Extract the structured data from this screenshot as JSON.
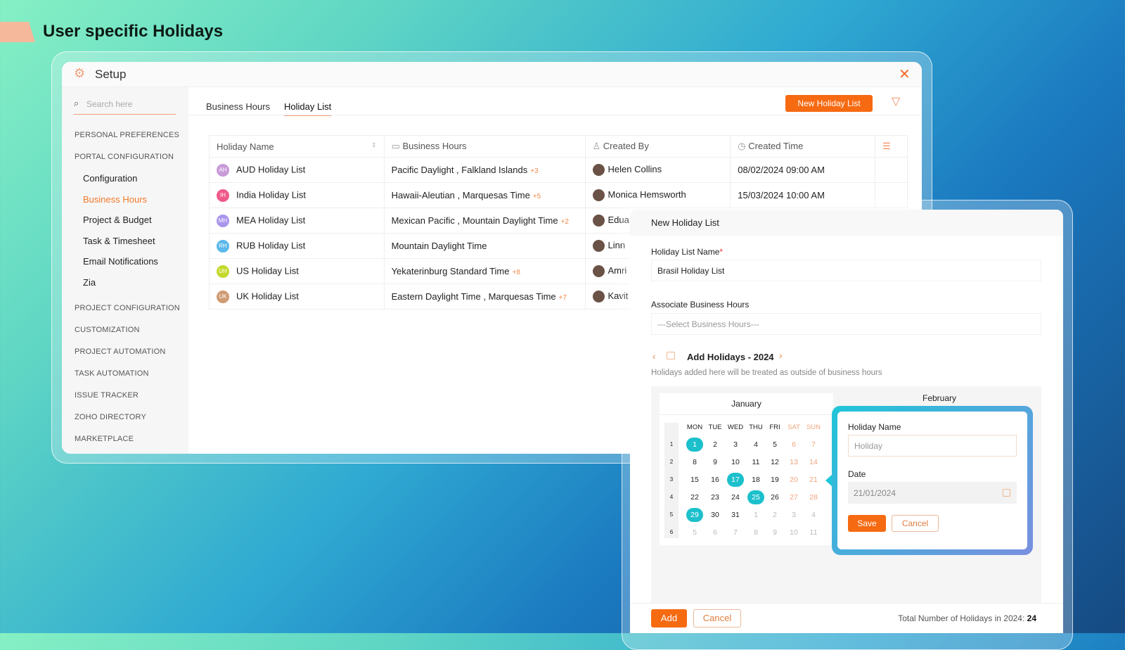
{
  "page_title": "User specific Holidays",
  "setup": {
    "title": "Setup",
    "search_placeholder": "Search here",
    "sidebar": [
      {
        "type": "section",
        "label": "PERSONAL PREFERENCES"
      },
      {
        "type": "section",
        "label": "PORTAL CONFIGURATION"
      },
      {
        "type": "item",
        "label": "Configuration"
      },
      {
        "type": "item",
        "label": "Business Hours",
        "active": true
      },
      {
        "type": "item",
        "label": "Project & Budget"
      },
      {
        "type": "item",
        "label": "Task & Timesheet"
      },
      {
        "type": "item",
        "label": "Email Notifications"
      },
      {
        "type": "item",
        "label": "Zia"
      },
      {
        "type": "section",
        "label": "PROJECT CONFIGURATION"
      },
      {
        "type": "section",
        "label": "CUSTOMIZATION"
      },
      {
        "type": "section",
        "label": "PROJECT AUTOMATION"
      },
      {
        "type": "section",
        "label": "TASK AUTOMATION"
      },
      {
        "type": "section",
        "label": "ISSUE TRACKER"
      },
      {
        "type": "section",
        "label": "ZOHO DIRECTORY"
      },
      {
        "type": "section",
        "label": "MARKETPLACE"
      }
    ],
    "tabs": [
      {
        "label": "Business Hours"
      },
      {
        "label": "Holiday List",
        "active": true
      }
    ],
    "new_button": "New Holiday List",
    "columns": [
      "Holiday Name",
      "Business Hours",
      "Created By",
      "Created Time"
    ],
    "rows": [
      {
        "initials": "AH",
        "color": "#c99ad8",
        "name": "AUD Holiday List",
        "hours": "Pacific Daylight , Falkland Islands",
        "more": "+3",
        "by": "Helen Collins",
        "time": "08/02/2024 09:00 AM"
      },
      {
        "initials": "IH",
        "color": "#ef5a8a",
        "name": "India Holiday List",
        "hours": "Hawaii-Aleutian , Marquesas Time",
        "more": "+5",
        "by": "Monica Hemsworth",
        "time": "15/03/2024 10:00 AM"
      },
      {
        "initials": "MH",
        "color": "#a995ec",
        "name": "MEA Holiday List",
        "hours": "Mexican Pacific , Mountain Daylight Time",
        "more": "+2",
        "by": "Edua",
        "time": ""
      },
      {
        "initials": "RH",
        "color": "#5ab8ea",
        "name": "RUB Holiday List",
        "hours": "Mountain Daylight Time",
        "more": "",
        "by": "Linn",
        "time": ""
      },
      {
        "initials": "UH",
        "color": "#c4d92c",
        "name": "US Holiday List",
        "hours": "Yekaterinburg Standard Time",
        "more": "+8",
        "by": "Amri",
        "time": ""
      },
      {
        "initials": "UK",
        "color": "#d09a72",
        "name": "UK Holiday List",
        "hours": "Eastern Daylight Time , Marquesas Time",
        "more": "+7",
        "by": "Kavit",
        "time": ""
      }
    ]
  },
  "new_list": {
    "title": "New Holiday List",
    "name_label": "Holiday List Name",
    "required_mark": "*",
    "name_value": "Brasil Holiday List",
    "hours_label": "Associate Business Hours",
    "hours_placeholder": "---Select Business Hours---",
    "add_title": "Add Holidays - 2024",
    "add_desc": "Holidays added here will be treated as outside of business hours",
    "month": "January",
    "next_month": "February",
    "weekdays": [
      "MON",
      "TUE",
      "WED",
      "THU",
      "FRI",
      "SAT",
      "SUN"
    ],
    "weeks": [
      {
        "n": "1",
        "days": [
          "1",
          "2",
          "3",
          "4",
          "5",
          "6",
          "7"
        ]
      },
      {
        "n": "2",
        "days": [
          "8",
          "9",
          "10",
          "11",
          "12",
          "13",
          "14"
        ]
      },
      {
        "n": "3",
        "days": [
          "15",
          "16",
          "17",
          "18",
          "19",
          "20",
          "21"
        ]
      },
      {
        "n": "4",
        "days": [
          "22",
          "23",
          "24",
          "25",
          "26",
          "27",
          "28"
        ]
      },
      {
        "n": "5",
        "days": [
          "29",
          "30",
          "31",
          "1",
          "2",
          "3",
          "4"
        ]
      },
      {
        "n": "6",
        "days": [
          "5",
          "6",
          "7",
          "8",
          "9",
          "10",
          "11"
        ]
      }
    ],
    "selected_days": [
      "1",
      "17",
      "25",
      "29"
    ],
    "popover": {
      "name_label": "Holiday Name",
      "name_placeholder": "Holiday",
      "date_label": "Date",
      "date_value": "21/01/2024",
      "save": "Save",
      "cancel": "Cancel"
    },
    "add": "Add",
    "cancel": "Cancel",
    "total_label": "Total Number of Holidays in 2024:",
    "total_value": "24"
  },
  "colors": {
    "accent": "#f66a12",
    "selected": "#1cc0cc",
    "weekend": "#f0a47a"
  }
}
